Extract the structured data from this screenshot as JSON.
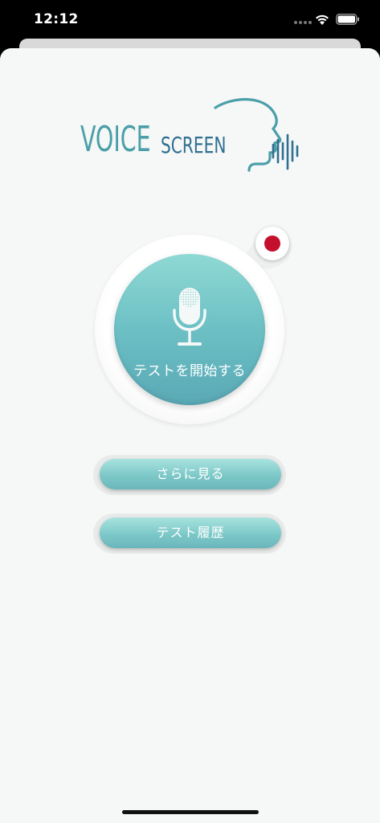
{
  "status_bar": {
    "time": "12:12"
  },
  "logo": {
    "voice_text": "VOICE",
    "screen_text": "SCREEN",
    "colors": {
      "voice": "#4a9fa8",
      "screen": "#2f6f8f"
    }
  },
  "main": {
    "start_test_label": "テストを開始する",
    "language_flag": "japan-flag-icon",
    "mic_icon": "microphone-icon"
  },
  "buttons": {
    "learn_more_label": "さらに見る",
    "test_history_label": "テスト履歴"
  },
  "colors": {
    "accent": "#6cc0c4",
    "background": "#f6f7f7",
    "flag_red": "#c4102d"
  }
}
